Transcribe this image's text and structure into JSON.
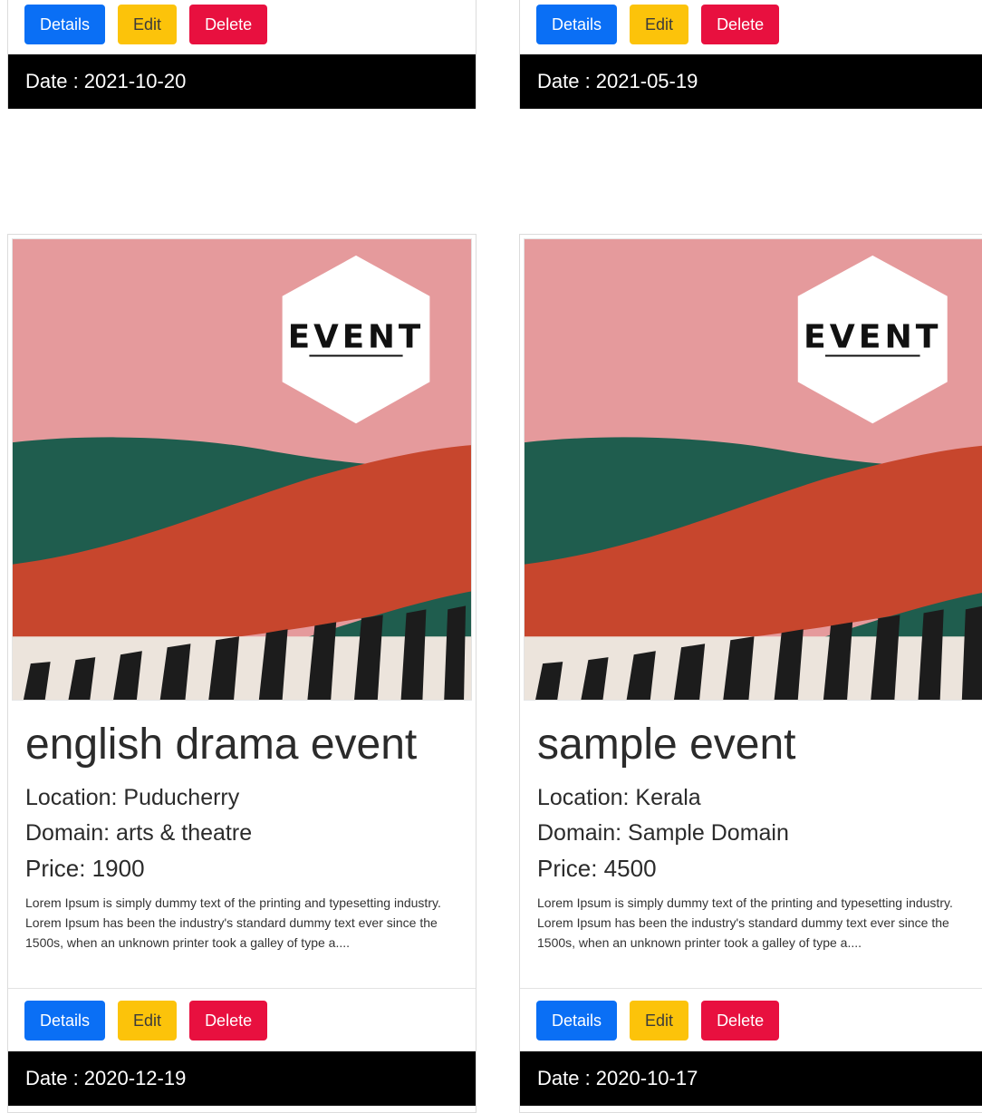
{
  "buttons": {
    "details": "Details",
    "edit": "Edit",
    "delete": "Delete"
  },
  "image": {
    "label": "EVENT"
  },
  "colors": {
    "details": "#0a6ff5",
    "edit": "#fcc30a",
    "delete": "#e8103f",
    "date_bar": "#000000",
    "poster_pink": "#e59a9c",
    "poster_green": "#1f5d4e",
    "poster_red": "#c7462d"
  },
  "cards": [
    {
      "date": "Date : 2021-10-20"
    },
    {
      "date": "Date : 2021-05-19"
    },
    {
      "title": "english drama event",
      "location": "Location: Puducherry",
      "domain": "Domain: arts & theatre",
      "price": "Price: 1900",
      "description": "Lorem Ipsum is simply dummy text of the printing and typesetting industry. Lorem Ipsum has been the industry's standard dummy text ever since the 1500s, when an unknown printer took a galley of type a....",
      "date": "Date : 2020-12-19"
    },
    {
      "title": "sample event",
      "location": "Location: Kerala",
      "domain": "Domain: Sample Domain",
      "price": "Price: 4500",
      "description": "Lorem Ipsum is simply dummy text of the printing and typesetting industry. Lorem Ipsum has been the industry's standard dummy text ever since the 1500s, when an unknown printer took a galley of type a....",
      "date": "Date : 2020-10-17"
    }
  ]
}
